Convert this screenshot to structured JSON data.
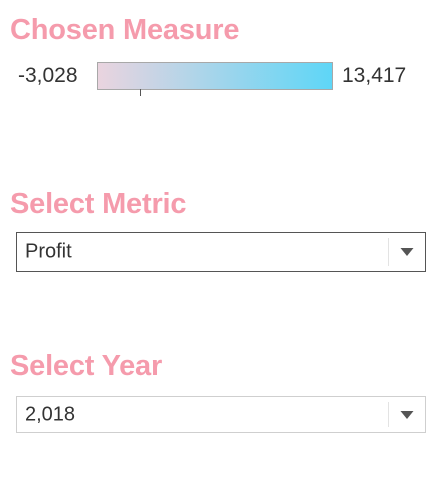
{
  "legend": {
    "title": "Chosen Measure",
    "min_label": "-3,028",
    "max_label": "13,417",
    "gradient": {
      "start_color": "#ead4df",
      "end_color": "#5ed6f7"
    },
    "marker_value": 0
  },
  "metric_filter": {
    "title": "Select Metric",
    "value": "Profit",
    "icon": "chevron-down-icon"
  },
  "year_filter": {
    "title": "Select Year",
    "value": "2,018",
    "icon": "chevron-down-icon"
  },
  "colors": {
    "title": "#f59bac",
    "text": "#333333",
    "arrow": "#555555"
  }
}
